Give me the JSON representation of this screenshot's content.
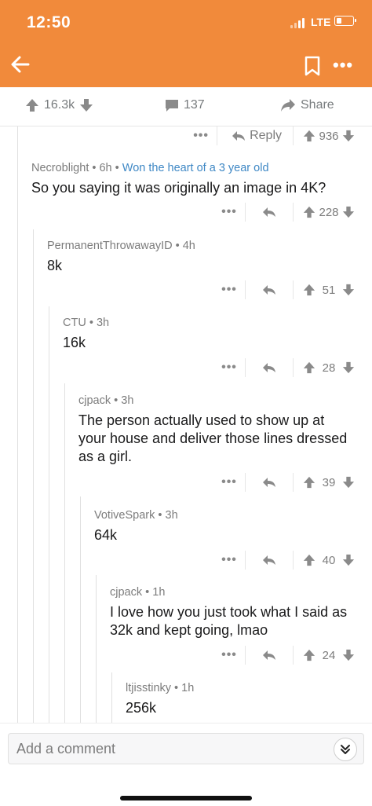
{
  "status_bar": {
    "time": "12:50",
    "network": "LTE"
  },
  "colors": {
    "header_bg": "#f18a3b",
    "flair": "#3f88c5"
  },
  "post_bar": {
    "upvotes": "16.3k",
    "comments": "137",
    "share_label": "Share"
  },
  "top_actions": {
    "reply_label": "Reply",
    "score": "936"
  },
  "comments": [
    {
      "author": "Necroblight",
      "age": "6h",
      "flair": "Won the heart of a 3 year old",
      "body": "So you saying it was originally an image in 4K?",
      "score": "228"
    },
    {
      "author": "PermanentThrowawayID",
      "age": "4h",
      "body": "8k",
      "score": "51"
    },
    {
      "author": "CTU",
      "age": "3h",
      "body": "16k",
      "score": "28"
    },
    {
      "author": "cjpack",
      "age": "3h",
      "body": "The person actually used to show up at your house and deliver those lines dressed as a girl.",
      "score": "39"
    },
    {
      "author": "VotiveSpark",
      "age": "3h",
      "body": "64k",
      "score": "40"
    },
    {
      "author": "cjpack",
      "age": "1h",
      "body": "I love how you just took what I said as 32k and kept going, lmao",
      "score": "24"
    },
    {
      "author": "ltjisstinky",
      "age": "1h",
      "body": "256k"
    }
  ],
  "bottom": {
    "comment_placeholder": "Add a comment"
  },
  "icons": {
    "back": "arrow-left-icon",
    "save": "bookmark-icon",
    "more": "more-icon",
    "upvote": "upvote-arrow-icon",
    "downvote": "downvote-arrow-icon",
    "comment": "comment-bubble-icon",
    "share": "share-arrow-icon",
    "reply": "reply-arrow-icon",
    "collapse": "double-chevron-down-icon"
  }
}
